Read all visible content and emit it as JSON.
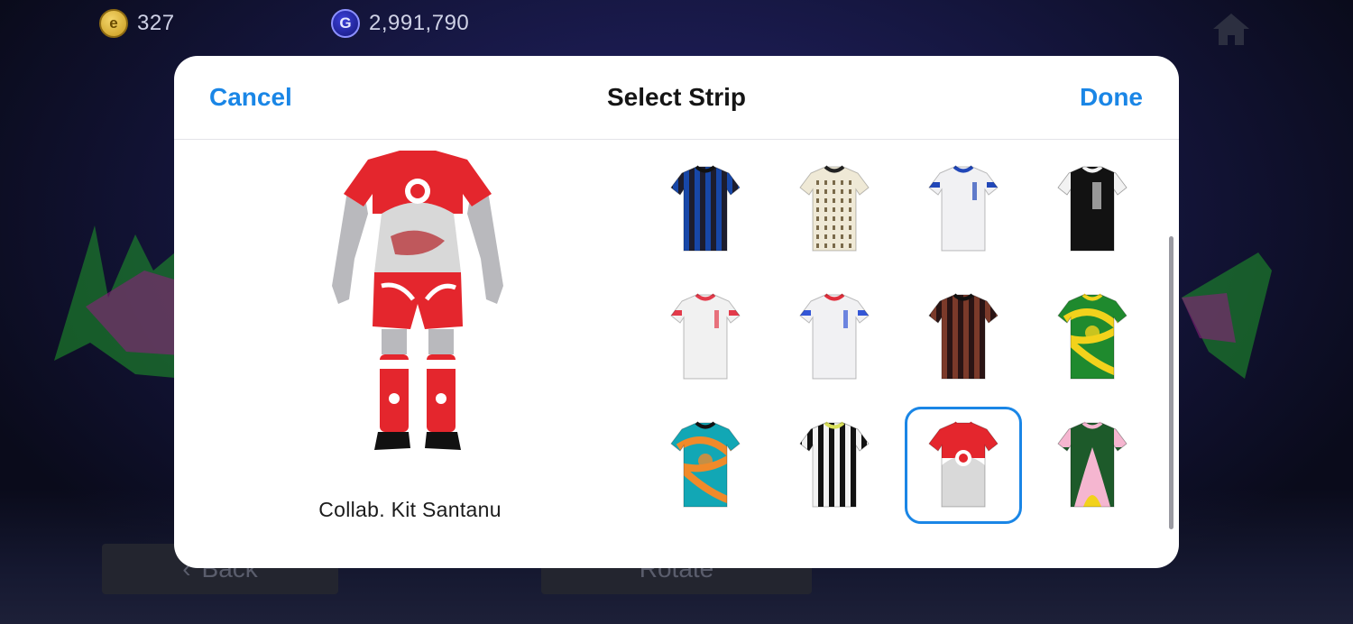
{
  "top_bar": {
    "coins": {
      "icon": "efootball-coin-icon",
      "symbol": "e",
      "value": "327"
    },
    "gp": {
      "icon": "gp-coin-icon",
      "symbol": "G",
      "value": "2,991,790"
    },
    "home_icon": "home-icon"
  },
  "background_buttons": {
    "back_label": "Back",
    "rotate_label": "Rotate"
  },
  "dialog": {
    "title": "Select Strip",
    "cancel_label": "Cancel",
    "done_label": "Done",
    "selected_kit_name": "Collab. Kit Santanu",
    "accent_color": "#1a86e6"
  },
  "strips": [
    {
      "name": "strip-blue-black-stripes",
      "base": "#1d1d2e",
      "pattern": "stripes",
      "alt": "#1747a8",
      "collar": "#111111"
    },
    {
      "name": "strip-cream-pattern",
      "base": "#efe9d6",
      "pattern": "dots",
      "alt": "#7a6a4a",
      "collar": "#222222"
    },
    {
      "name": "strip-white-blue-collar",
      "base": "#f1f1f3",
      "pattern": "plain",
      "alt": "#2147b8",
      "collar": "#2147b8"
    },
    {
      "name": "strip-black-white-sleeves",
      "base": "#121212",
      "pattern": "sleeves",
      "alt": "#f2f2f2",
      "collar": "#f2f2f2"
    },
    {
      "name": "strip-white-red-accent",
      "base": "#f1f1f1",
      "pattern": "plain",
      "alt": "#e33a4a",
      "collar": "#e33a4a"
    },
    {
      "name": "strip-white-blue-red",
      "base": "#f1f1f3",
      "pattern": "plain",
      "alt": "#3356d6",
      "collar": "#e02f3c"
    },
    {
      "name": "strip-dark-brown-floral",
      "base": "#2a1414",
      "pattern": "stripes",
      "alt": "#7b3a2a",
      "collar": "#111111"
    },
    {
      "name": "strip-green-yellow-swirl",
      "base": "#1f8a2e",
      "pattern": "swirl",
      "alt": "#f2d21c",
      "collar": "#f2d21c"
    },
    {
      "name": "strip-teal-tie-dye",
      "base": "#12a7b5",
      "pattern": "swirl",
      "alt": "#f08a2a",
      "collar": "#121212"
    },
    {
      "name": "strip-black-white-stripes",
      "base": "#121212",
      "pattern": "stripes",
      "alt": "#f2f2f2",
      "collar": "#d9e05a"
    },
    {
      "name": "strip-red-white-collab",
      "base": "#ffffff",
      "pattern": "collab",
      "alt": "#e4262d",
      "collar": "#e4262d",
      "selected": true
    },
    {
      "name": "strip-green-pink-flame",
      "base": "#1d5a2a",
      "pattern": "flame",
      "alt": "#f5b6d0",
      "collar": "#f5b6d0"
    }
  ]
}
